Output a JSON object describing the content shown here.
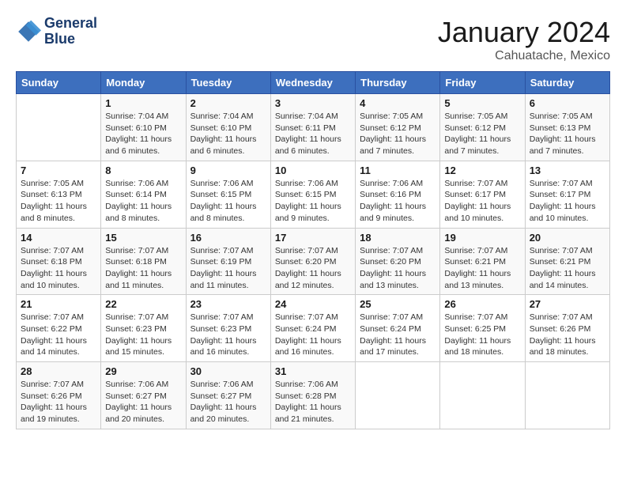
{
  "header": {
    "logo_line1": "General",
    "logo_line2": "Blue",
    "month": "January 2024",
    "location": "Cahuatache, Mexico"
  },
  "weekdays": [
    "Sunday",
    "Monday",
    "Tuesday",
    "Wednesday",
    "Thursday",
    "Friday",
    "Saturday"
  ],
  "weeks": [
    [
      {
        "day": "",
        "sunrise": "",
        "sunset": "",
        "daylight": ""
      },
      {
        "day": "1",
        "sunrise": "7:04 AM",
        "sunset": "6:10 PM",
        "daylight": "11 hours and 6 minutes."
      },
      {
        "day": "2",
        "sunrise": "7:04 AM",
        "sunset": "6:10 PM",
        "daylight": "11 hours and 6 minutes."
      },
      {
        "day": "3",
        "sunrise": "7:04 AM",
        "sunset": "6:11 PM",
        "daylight": "11 hours and 6 minutes."
      },
      {
        "day": "4",
        "sunrise": "7:05 AM",
        "sunset": "6:12 PM",
        "daylight": "11 hours and 7 minutes."
      },
      {
        "day": "5",
        "sunrise": "7:05 AM",
        "sunset": "6:12 PM",
        "daylight": "11 hours and 7 minutes."
      },
      {
        "day": "6",
        "sunrise": "7:05 AM",
        "sunset": "6:13 PM",
        "daylight": "11 hours and 7 minutes."
      }
    ],
    [
      {
        "day": "7",
        "sunrise": "7:05 AM",
        "sunset": "6:13 PM",
        "daylight": "11 hours and 8 minutes."
      },
      {
        "day": "8",
        "sunrise": "7:06 AM",
        "sunset": "6:14 PM",
        "daylight": "11 hours and 8 minutes."
      },
      {
        "day": "9",
        "sunrise": "7:06 AM",
        "sunset": "6:15 PM",
        "daylight": "11 hours and 8 minutes."
      },
      {
        "day": "10",
        "sunrise": "7:06 AM",
        "sunset": "6:15 PM",
        "daylight": "11 hours and 9 minutes."
      },
      {
        "day": "11",
        "sunrise": "7:06 AM",
        "sunset": "6:16 PM",
        "daylight": "11 hours and 9 minutes."
      },
      {
        "day": "12",
        "sunrise": "7:07 AM",
        "sunset": "6:17 PM",
        "daylight": "11 hours and 10 minutes."
      },
      {
        "day": "13",
        "sunrise": "7:07 AM",
        "sunset": "6:17 PM",
        "daylight": "11 hours and 10 minutes."
      }
    ],
    [
      {
        "day": "14",
        "sunrise": "7:07 AM",
        "sunset": "6:18 PM",
        "daylight": "11 hours and 10 minutes."
      },
      {
        "day": "15",
        "sunrise": "7:07 AM",
        "sunset": "6:18 PM",
        "daylight": "11 hours and 11 minutes."
      },
      {
        "day": "16",
        "sunrise": "7:07 AM",
        "sunset": "6:19 PM",
        "daylight": "11 hours and 11 minutes."
      },
      {
        "day": "17",
        "sunrise": "7:07 AM",
        "sunset": "6:20 PM",
        "daylight": "11 hours and 12 minutes."
      },
      {
        "day": "18",
        "sunrise": "7:07 AM",
        "sunset": "6:20 PM",
        "daylight": "11 hours and 13 minutes."
      },
      {
        "day": "19",
        "sunrise": "7:07 AM",
        "sunset": "6:21 PM",
        "daylight": "11 hours and 13 minutes."
      },
      {
        "day": "20",
        "sunrise": "7:07 AM",
        "sunset": "6:21 PM",
        "daylight": "11 hours and 14 minutes."
      }
    ],
    [
      {
        "day": "21",
        "sunrise": "7:07 AM",
        "sunset": "6:22 PM",
        "daylight": "11 hours and 14 minutes."
      },
      {
        "day": "22",
        "sunrise": "7:07 AM",
        "sunset": "6:23 PM",
        "daylight": "11 hours and 15 minutes."
      },
      {
        "day": "23",
        "sunrise": "7:07 AM",
        "sunset": "6:23 PM",
        "daylight": "11 hours and 16 minutes."
      },
      {
        "day": "24",
        "sunrise": "7:07 AM",
        "sunset": "6:24 PM",
        "daylight": "11 hours and 16 minutes."
      },
      {
        "day": "25",
        "sunrise": "7:07 AM",
        "sunset": "6:24 PM",
        "daylight": "11 hours and 17 minutes."
      },
      {
        "day": "26",
        "sunrise": "7:07 AM",
        "sunset": "6:25 PM",
        "daylight": "11 hours and 18 minutes."
      },
      {
        "day": "27",
        "sunrise": "7:07 AM",
        "sunset": "6:26 PM",
        "daylight": "11 hours and 18 minutes."
      }
    ],
    [
      {
        "day": "28",
        "sunrise": "7:07 AM",
        "sunset": "6:26 PM",
        "daylight": "11 hours and 19 minutes."
      },
      {
        "day": "29",
        "sunrise": "7:06 AM",
        "sunset": "6:27 PM",
        "daylight": "11 hours and 20 minutes."
      },
      {
        "day": "30",
        "sunrise": "7:06 AM",
        "sunset": "6:27 PM",
        "daylight": "11 hours and 20 minutes."
      },
      {
        "day": "31",
        "sunrise": "7:06 AM",
        "sunset": "6:28 PM",
        "daylight": "11 hours and 21 minutes."
      },
      {
        "day": "",
        "sunrise": "",
        "sunset": "",
        "daylight": ""
      },
      {
        "day": "",
        "sunrise": "",
        "sunset": "",
        "daylight": ""
      },
      {
        "day": "",
        "sunrise": "",
        "sunset": "",
        "daylight": ""
      }
    ]
  ]
}
